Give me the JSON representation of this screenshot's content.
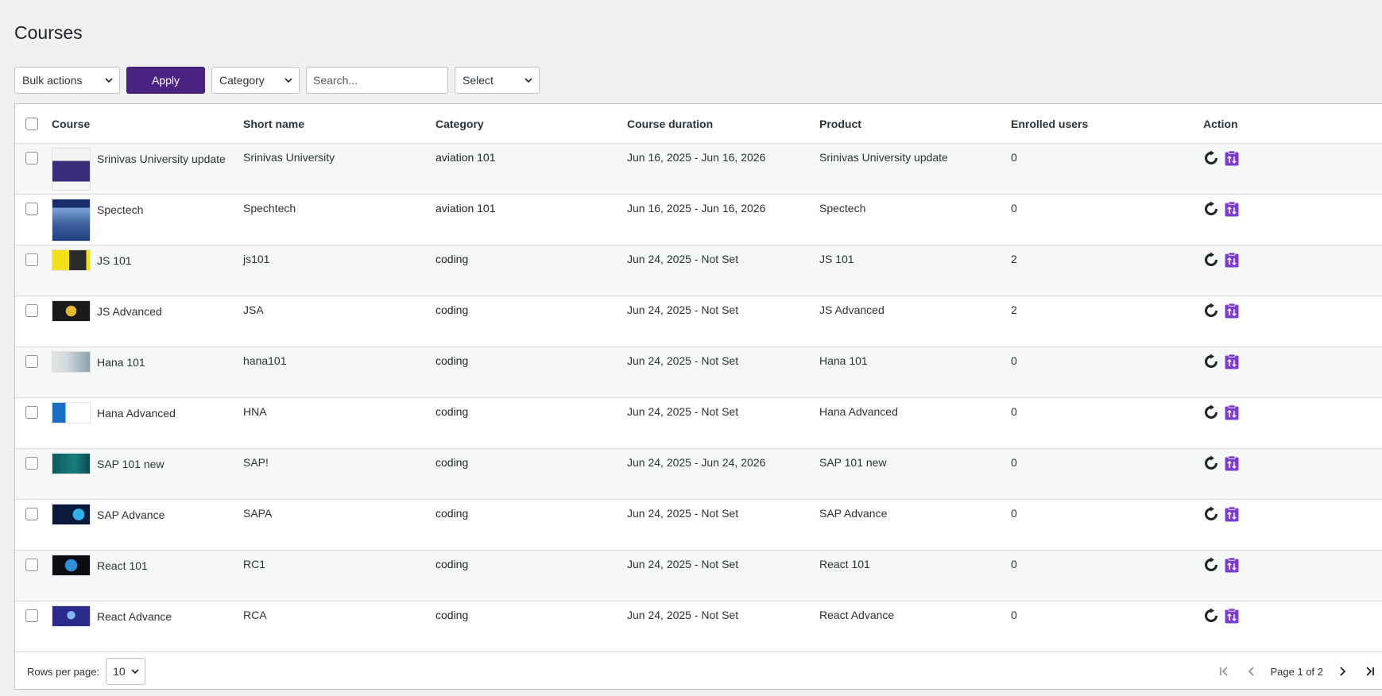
{
  "page": {
    "title": "Courses"
  },
  "toolbar": {
    "bulk_actions": "Bulk actions",
    "apply_label": "Apply",
    "category_filter": "Category",
    "search_placeholder": "Search...",
    "select_filter": "Select"
  },
  "table": {
    "columns": {
      "course": "Course",
      "short_name": "Short name",
      "category": "Category",
      "duration": "Course duration",
      "product": "Product",
      "enrolled": "Enrolled users",
      "action": "Action"
    },
    "rows": [
      {
        "course": "Srinivas University update",
        "short_name": "Srinivas University",
        "category": "aviation 101",
        "duration": "Jun 16, 2025 - Jun 16, 2026",
        "product": "Srinivas University update",
        "enrolled": "0"
      },
      {
        "course": "Spectech",
        "short_name": "Spechtech",
        "category": "aviation 101",
        "duration": "Jun 16, 2025 - Jun 16, 2026",
        "product": "Spectech",
        "enrolled": "0"
      },
      {
        "course": "JS 101",
        "short_name": "js101",
        "category": "coding",
        "duration": "Jun 24, 2025 - Not Set",
        "product": "JS 101",
        "enrolled": "2"
      },
      {
        "course": "JS Advanced",
        "short_name": "JSA",
        "category": "coding",
        "duration": "Jun 24, 2025 - Not Set",
        "product": "JS Advanced",
        "enrolled": "2"
      },
      {
        "course": "Hana 101",
        "short_name": "hana101",
        "category": "coding",
        "duration": "Jun 24, 2025 - Not Set",
        "product": "Hana 101",
        "enrolled": "0"
      },
      {
        "course": "Hana Advanced",
        "short_name": "HNA",
        "category": "coding",
        "duration": "Jun 24, 2025 - Not Set",
        "product": "Hana Advanced",
        "enrolled": "0"
      },
      {
        "course": "SAP 101 new",
        "short_name": "SAP!",
        "category": "coding",
        "duration": "Jun 24, 2025 - Jun 24, 2026",
        "product": "SAP 101 new",
        "enrolled": "0"
      },
      {
        "course": "SAP Advance",
        "short_name": "SAPA",
        "category": "coding",
        "duration": "Jun 24, 2025 - Not Set",
        "product": "SAP Advance",
        "enrolled": "0"
      },
      {
        "course": "React 101",
        "short_name": "RC1",
        "category": "coding",
        "duration": "Jun 24, 2025 - Not Set",
        "product": "React 101",
        "enrolled": "0"
      },
      {
        "course": "React Advance",
        "short_name": "RCA",
        "category": "coding",
        "duration": "Jun 24, 2025 - Not Set",
        "product": "React Advance",
        "enrolled": "0"
      }
    ]
  },
  "footer": {
    "rows_per_page_label": "Rows per page:",
    "rows_per_page_value": "10",
    "page_info": "Page 1 of 2"
  },
  "colors": {
    "accent": "#4b2383",
    "action_icon": "#7e3bd0"
  },
  "icons": {
    "reset": "reset-icon",
    "enroll": "enroll-clipboard-icon"
  }
}
